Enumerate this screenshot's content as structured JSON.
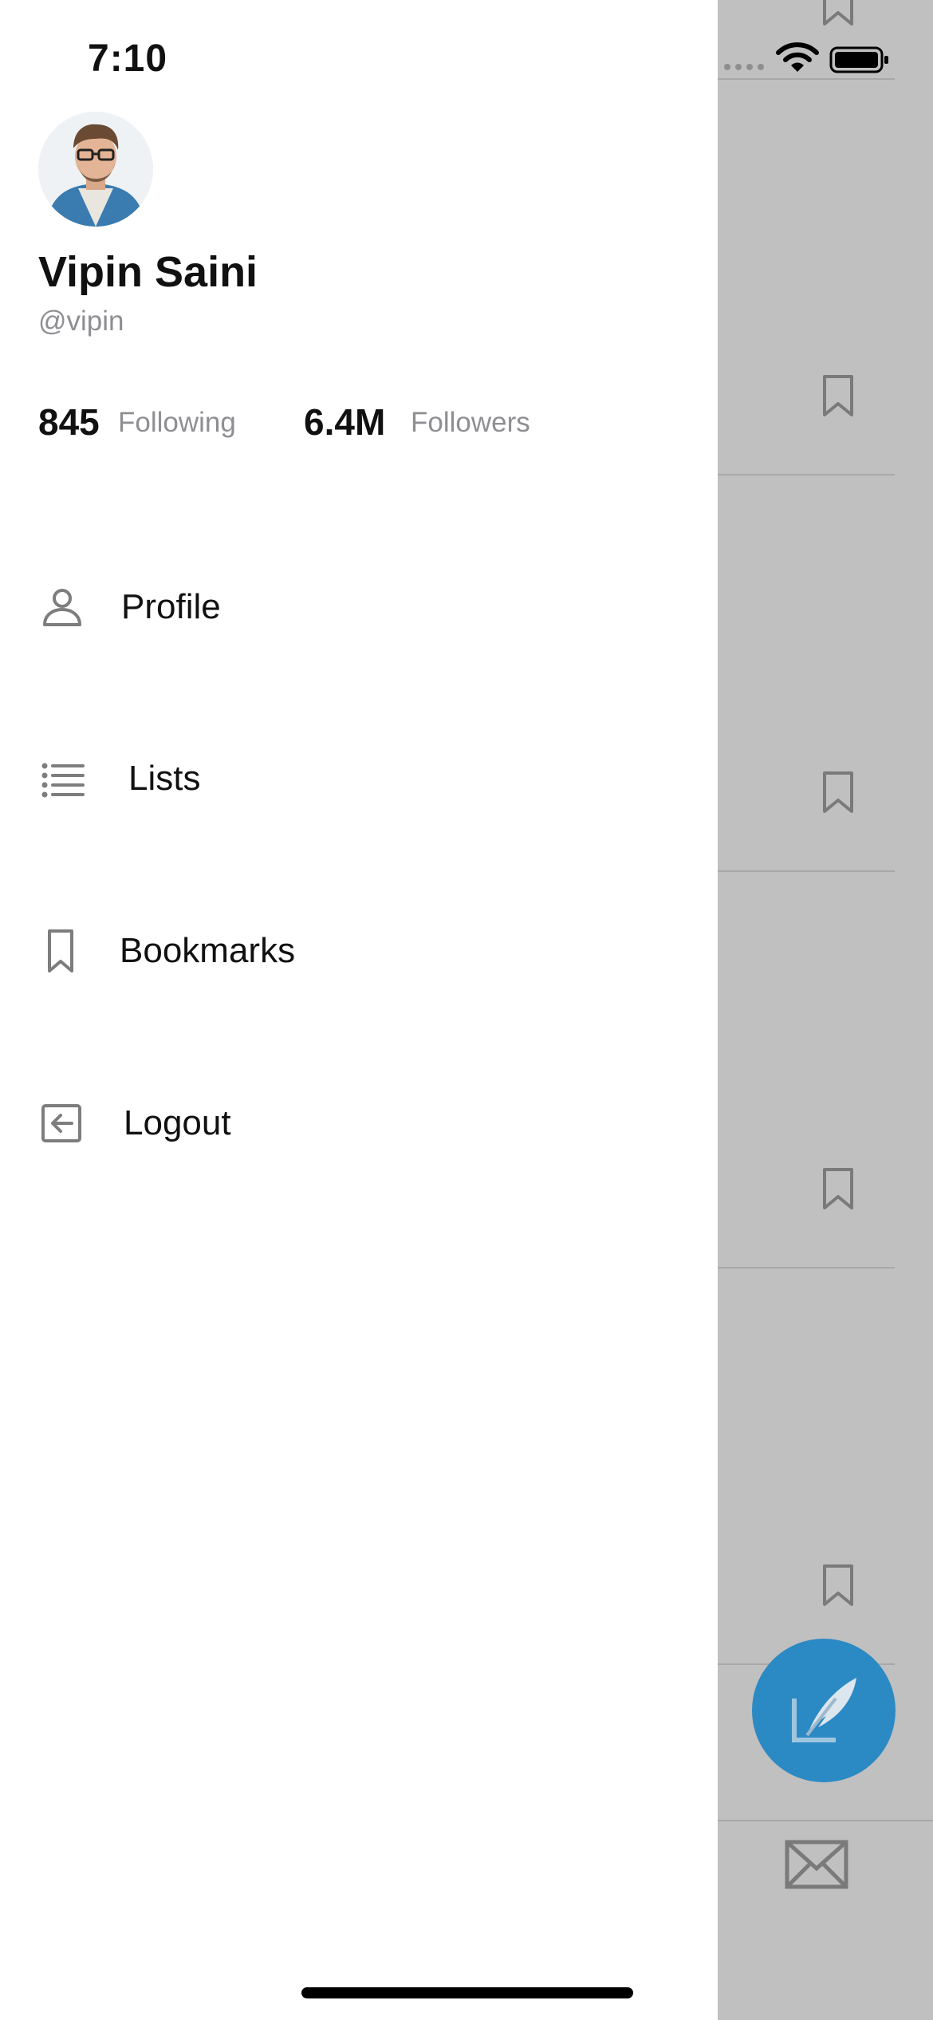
{
  "status_bar": {
    "time": "7:10"
  },
  "profile": {
    "name": "Vipin Saini",
    "handle": "@vipin",
    "following_count": "845",
    "following_label": "Following",
    "followers_count": "6.4M",
    "followers_label": "Followers"
  },
  "menu": {
    "items": [
      {
        "label": "Profile",
        "icon": "person-icon"
      },
      {
        "label": "Lists",
        "icon": "list-icon"
      },
      {
        "label": "Bookmarks",
        "icon": "bookmark-icon"
      },
      {
        "label": "Logout",
        "icon": "logout-icon"
      }
    ]
  },
  "colors": {
    "accent": "#2b89c4",
    "backdrop": "#c0c0c0",
    "secondary_text": "#8e8e93",
    "icon_gray": "#7d7d7d"
  }
}
